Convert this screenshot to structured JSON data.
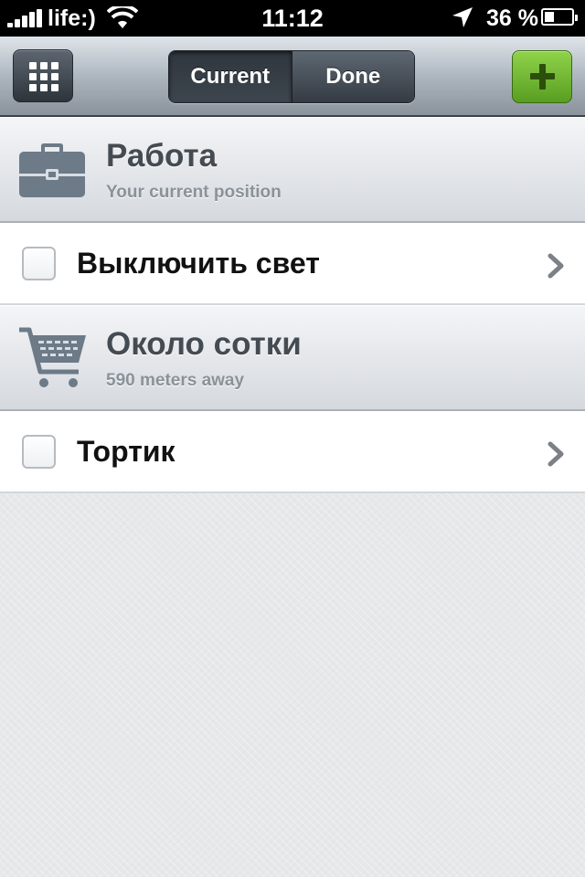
{
  "status_bar": {
    "carrier": "life:)",
    "time": "11:12",
    "battery_percent_label": "36 %",
    "battery_level": 0.36
  },
  "nav": {
    "menu_icon": "grid-icon",
    "segments": [
      {
        "label": "Current",
        "active": true
      },
      {
        "label": "Done",
        "active": false
      }
    ],
    "add_icon": "plus-icon",
    "add_color": "#6fb830"
  },
  "groups": [
    {
      "icon": "briefcase-icon",
      "title": "Работа",
      "subtitle": "Your current position",
      "tasks": [
        {
          "label": "Выключить свет",
          "done": false
        }
      ]
    },
    {
      "icon": "shopping-cart-icon",
      "title": "Около сотки",
      "subtitle": "590 meters away",
      "tasks": [
        {
          "label": "Тортик",
          "done": false
        }
      ]
    }
  ]
}
